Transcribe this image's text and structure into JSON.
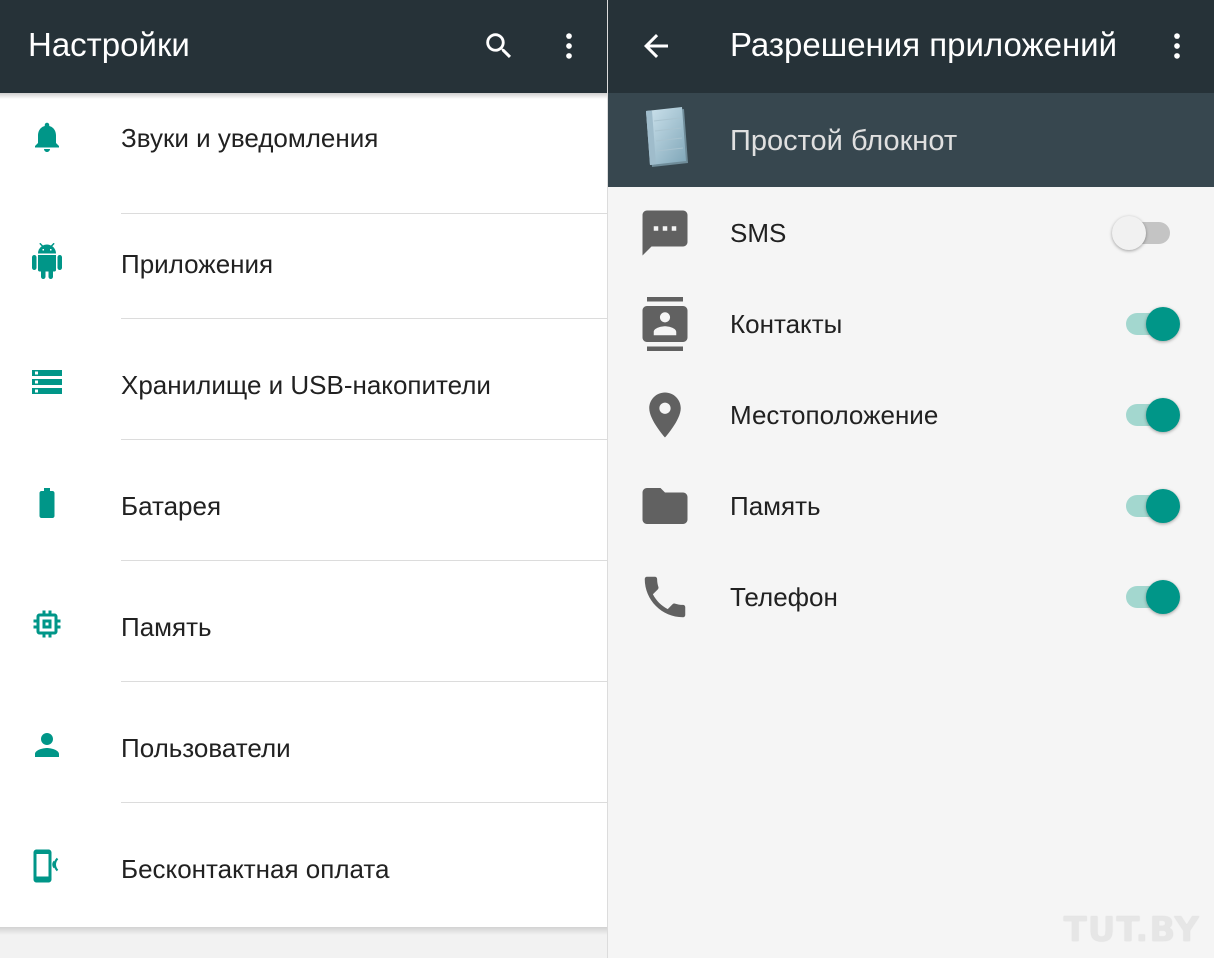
{
  "settings": {
    "title": "Настройки",
    "items": [
      {
        "label": "Звуки и уведомления",
        "icon": "bell-icon"
      },
      {
        "label": "Приложения",
        "icon": "android-icon"
      },
      {
        "label": "Хранилище и USB-накопители",
        "icon": "storage-icon"
      },
      {
        "label": "Батарея",
        "icon": "battery-icon"
      },
      {
        "label": "Память",
        "icon": "memory-chip-icon"
      },
      {
        "label": "Пользователи",
        "icon": "person-icon"
      },
      {
        "label": "Бесконтактная оплата",
        "icon": "nfc-phone-icon"
      }
    ]
  },
  "permissions": {
    "title": "Разрешения приложений",
    "app_name": "Простой блокнот",
    "items": [
      {
        "label": "SMS",
        "icon": "sms-icon",
        "enabled": false
      },
      {
        "label": "Контакты",
        "icon": "contacts-icon",
        "enabled": true
      },
      {
        "label": "Местоположение",
        "icon": "location-icon",
        "enabled": true
      },
      {
        "label": "Память",
        "icon": "folder-icon",
        "enabled": true
      },
      {
        "label": "Телефон",
        "icon": "phone-icon",
        "enabled": true
      }
    ]
  },
  "watermark": "TUT.BY",
  "colors": {
    "appbar": "#263238",
    "app_header": "#37474f",
    "accent": "#009688",
    "icon_grey": "#616161"
  }
}
